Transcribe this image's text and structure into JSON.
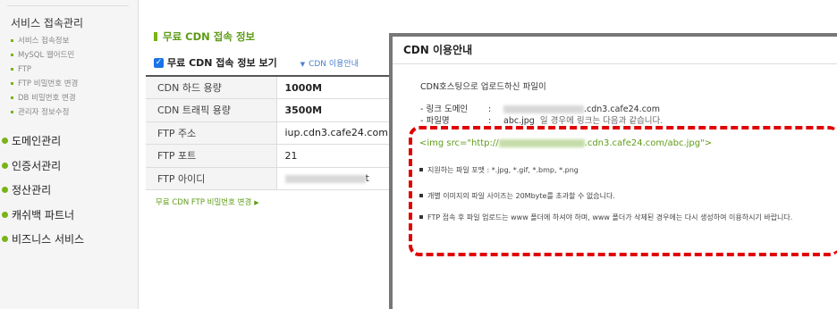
{
  "sidebar": {
    "section_title": "서비스 접속관리",
    "sub_items": [
      {
        "label": "서비스 접속정보"
      },
      {
        "label": "MySQL 웹어드민"
      },
      {
        "label": "FTP"
      },
      {
        "label": "FTP 비밀번호 변경"
      },
      {
        "label": "DB 비밀번호 변경"
      },
      {
        "label": "관리자 정보수정"
      }
    ],
    "main_items": [
      {
        "label": "도메인관리"
      },
      {
        "label": "인증서관리"
      },
      {
        "label": "정산관리"
      },
      {
        "label": "캐쉬백 파트너"
      },
      {
        "label": "비즈니스 서비스"
      }
    ]
  },
  "main": {
    "title": "무료 CDN 접속 정보",
    "checkbox_label": "무료 CDN 접속 정보 보기",
    "guide_link": "CDN 이용안내",
    "rows": [
      {
        "key": "CDN 하드 용량",
        "value": "1000M"
      },
      {
        "key": "CDN 트래픽 용량",
        "value": "3500M"
      },
      {
        "key": "FTP 주소",
        "value": "iup.cdn3.cafe24.com"
      },
      {
        "key": "FTP 포트",
        "value": "21"
      },
      {
        "key": "FTP 아이디",
        "value": "t"
      }
    ],
    "password_link": "무료 CDN FTP 비밀번호 변경"
  },
  "popup": {
    "title": "CDN 이용안내",
    "description": "CDN호스팅으로 업로드하신 파일이",
    "link_domain_label": "- 링크 도메인",
    "link_domain_value": ".cdn3.cafe24.com",
    "filename_label": "- 파일명",
    "filename_value": "abc.jpg",
    "filename_note": "일 경우에 링크는 다음과 같습니다.",
    "colon": ":",
    "code_prefix": "<img src=\"http://",
    "code_suffix": ".cdn3.cafe24.com/abc.jpg\">",
    "notes": [
      "지원하는 파일 포맷 : *.jpg, *.gif, *.bmp, *.png",
      "개별 이미지의 파일 사이즈는 20Mbyte를 초과할 수 없습니다.",
      "FTP 접속 후 파일 업로드는 www 폴더에 하셔야 하며, www 폴더가 삭제된 경우에는 다시 생성하여 이용하시기 바랍니다."
    ]
  },
  "colors": {
    "accent_green": "#7ab317",
    "title_green": "#5e9c17",
    "highlight_red": "#e00000",
    "link_blue": "#4a7fcc"
  }
}
